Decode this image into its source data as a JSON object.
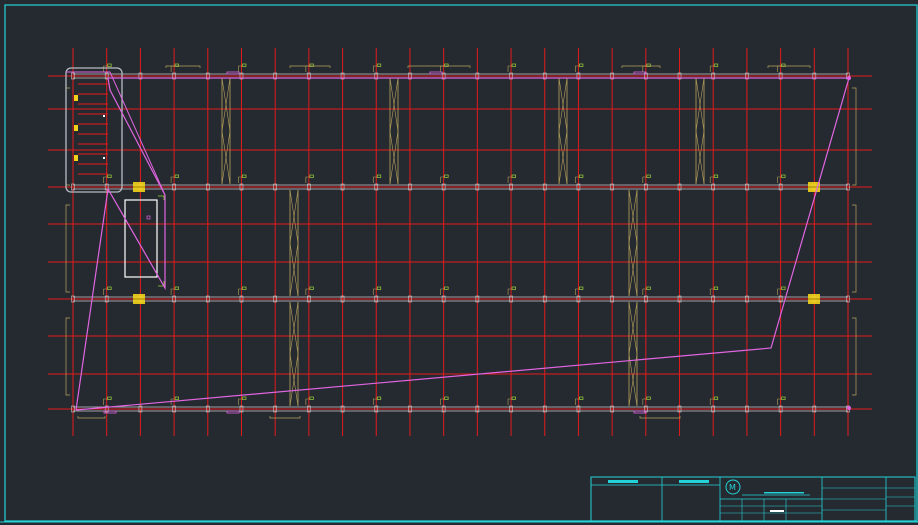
{
  "drawing": {
    "grid_columns": 24,
    "grid_rows": 10,
    "colors": {
      "background": "#252a31",
      "frame": "#23d3d8",
      "grid": "#e21b1b",
      "beam": "#c7c7c7",
      "stair": "#b8a25a",
      "outline": "#e065e0",
      "tag": "#9ad23a",
      "highlight": "#f3d21a",
      "white": "#ffffff"
    },
    "vertical_notes": [
      {
        "text": ""
      },
      {
        "text": ""
      }
    ]
  },
  "title_block": {
    "company": "",
    "project": "",
    "drawing_name": "",
    "scale": "",
    "sheet": ""
  }
}
